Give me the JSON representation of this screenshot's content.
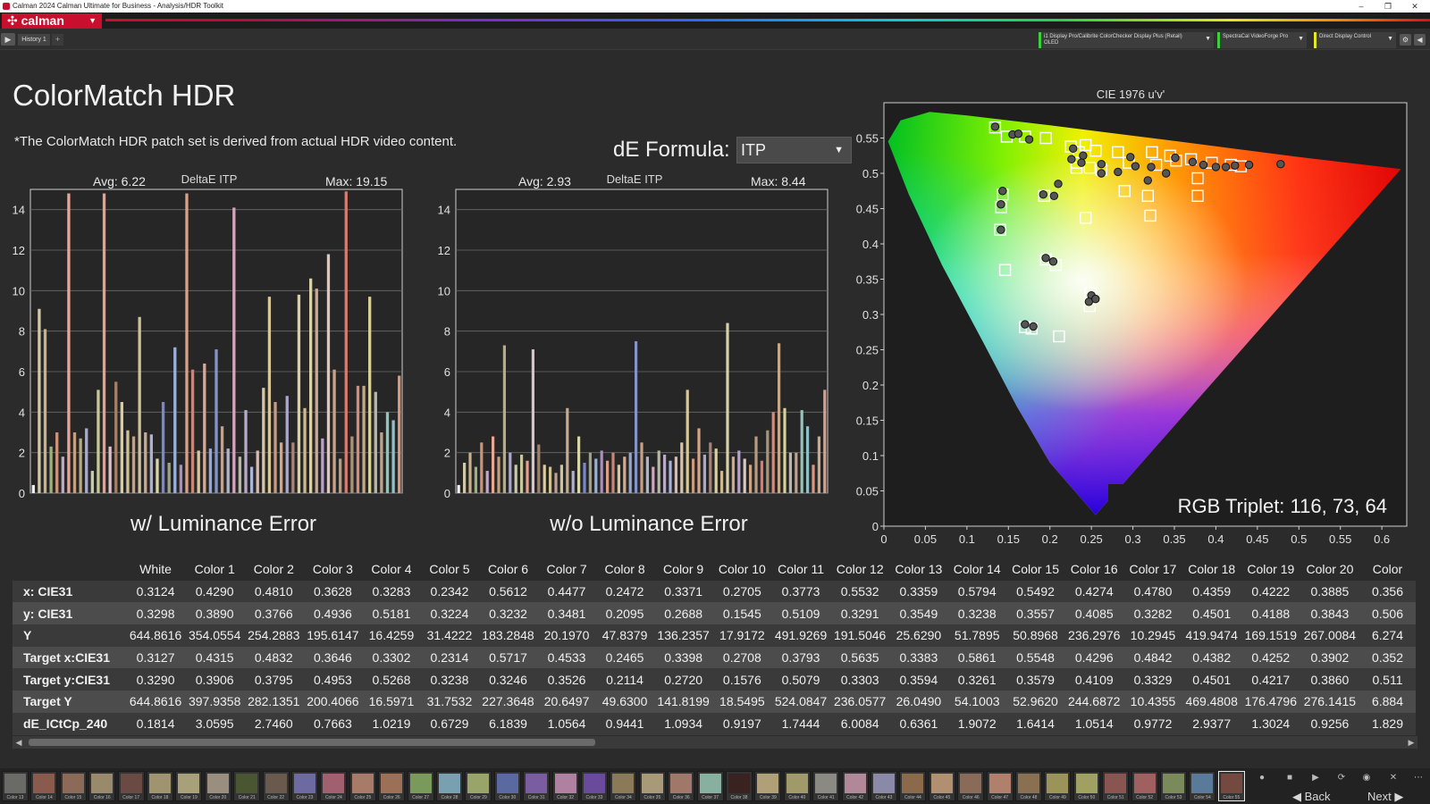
{
  "window": {
    "title": "Calman 2024 Calman Ultimate for Business - Analysis/HDR Toolkit",
    "controls": [
      "–",
      "❐",
      "✕"
    ]
  },
  "brand": {
    "logo": "calman"
  },
  "tabs": {
    "history": "History 1",
    "add": "+"
  },
  "devices": [
    {
      "line1": "i1 Display Pro/Calibrite ColorChecker Display Plus (Retail)",
      "line2": "OLED",
      "color": "#3bd13b"
    },
    {
      "line1": "SpectraCal VideoForge Pro",
      "line2": "",
      "color": "#3bd13b"
    },
    {
      "line1": "Direct Display Control",
      "line2": "",
      "color": "#e8e820"
    }
  ],
  "page": {
    "title": "ColorMatch HDR",
    "note": "*The ColorMatch HDR patch set is derived from actual HDR video content.",
    "formula_label": "dE Formula:",
    "formula_value": "ITP"
  },
  "chart_data": [
    {
      "type": "bar",
      "title": "DeltaE ITP",
      "caption": "w/ Luminance Error",
      "avg_label": "Avg: 6.22",
      "max_label": "Max: 19.15",
      "ylim": [
        0,
        15
      ],
      "yticks": [
        0,
        2,
        4,
        6,
        8,
        10,
        12,
        14
      ],
      "values": [
        0.4,
        9.1,
        8.1,
        2.3,
        3.0,
        1.8,
        14.8,
        3.0,
        2.7,
        3.2,
        1.1,
        5.1,
        14.8,
        2.3,
        5.5,
        4.5,
        3.1,
        2.8,
        8.7,
        3.0,
        2.9,
        1.7,
        4.5,
        1.5,
        7.2,
        1.4,
        14.8,
        6.1,
        2.1,
        6.4,
        2.2,
        7.1,
        3.3,
        2.2,
        14.1,
        1.8,
        4.1,
        1.3,
        2.1,
        5.2,
        9.7,
        4.5,
        2.5,
        4.8,
        2.5,
        9.8,
        4.2,
        10.6,
        10.1,
        2.7,
        11.8,
        6.1,
        1.7,
        14.9,
        2.8,
        5.3,
        5.3,
        9.7,
        5.0,
        3.0,
        4.0,
        3.6,
        5.8
      ],
      "colors": [
        "#f2f2f2",
        "#d0c8a8",
        "#c9b28a",
        "#9fb07c",
        "#cc9378",
        "#c0a8c8",
        "#e8a696",
        "#c3a07e",
        "#b8aa85",
        "#a8a8d0",
        "#c9c9b0",
        "#c8c79a",
        "#e8a08c",
        "#dbc2c8",
        "#a48068",
        "#d8cca0",
        "#cfc191",
        "#c0a090",
        "#cdc29a",
        "#c8aa8e",
        "#b0b0c8",
        "#d6d6a8",
        "#7b87c8",
        "#9ea288",
        "#9ab0d8",
        "#a890b8",
        "#d8a086",
        "#c6867a",
        "#d8c69a",
        "#d8a890",
        "#9aa8c8",
        "#8494c8",
        "#c8a088",
        "#b0b4c8",
        "#d6a4bc",
        "#b8b8a8",
        "#b8aac8",
        "#a8b4d8",
        "#dab8b0",
        "#d8c4a0",
        "#d8c899",
        "#c89a80",
        "#d6a588",
        "#a8a8c8",
        "#a88478",
        "#d9cfa2",
        "#cdb890",
        "#d8d0a8",
        "#cba892",
        "#b8a0d0",
        "#d8c8c0",
        "#c9a487",
        "#b89c80",
        "#d87b6e",
        "#a89478",
        "#d08c7c",
        "#c4a888",
        "#d8d098",
        "#b8b8a8",
        "#c0a48a",
        "#9ac0b8",
        "#8ec0c8",
        "#d89880"
      ]
    },
    {
      "type": "bar",
      "title": "DeltaE ITP",
      "caption": "w/o Luminance Error",
      "avg_label": "Avg: 2.93",
      "max_label": "Max: 8.44",
      "ylim": [
        0,
        15
      ],
      "yticks": [
        0,
        2,
        4,
        6,
        8,
        10,
        12,
        14
      ],
      "values": [
        0.4,
        1.5,
        2.0,
        1.3,
        2.5,
        1.1,
        2.8,
        1.8,
        7.3,
        2.0,
        1.4,
        1.9,
        1.6,
        7.1,
        2.4,
        1.4,
        1.3,
        1.0,
        1.4,
        4.2,
        1.1,
        2.8,
        1.5,
        2.0,
        1.7,
        2.1,
        1.6,
        2.0,
        1.4,
        1.8,
        2.0,
        7.5,
        2.5,
        1.8,
        1.3,
        2.1,
        1.9,
        1.6,
        1.8,
        2.5,
        5.1,
        1.7,
        3.2,
        1.9,
        2.5,
        2.2,
        1.1,
        8.4,
        1.8,
        2.1,
        1.7,
        1.4,
        2.8,
        1.6,
        3.1,
        4.0,
        7.4,
        4.2,
        2.0,
        2.0,
        4.1,
        3.3,
        1.4,
        2.8,
        5.1
      ],
      "colors": [
        "#f2f2f2",
        "#d0c8a8",
        "#c9b28a",
        "#9fb07c",
        "#cc9378",
        "#c0a8c8",
        "#e8a696",
        "#c3a07e",
        "#b8aa85",
        "#a8a8d0",
        "#c9c9b0",
        "#c8c79a",
        "#e8a08c",
        "#dbc2c8",
        "#a48068",
        "#d8cca0",
        "#cfc191",
        "#c0a090",
        "#cdc29a",
        "#c8aa8e",
        "#b0b0c8",
        "#d6d6a8",
        "#7b87c8",
        "#9ea288",
        "#9ab0d8",
        "#a890b8",
        "#d8a086",
        "#c6867a",
        "#d8c69a",
        "#d8a890",
        "#9aa8c8",
        "#8494c8",
        "#c8a088",
        "#b0b4c8",
        "#d6a4bc",
        "#b8b8a8",
        "#b8aac8",
        "#a8b4d8",
        "#dab8b0",
        "#d8c4a0",
        "#d8c899",
        "#c89a80",
        "#d6a588",
        "#a8a8c8",
        "#a88478",
        "#d9cfa2",
        "#cdb890",
        "#d8d0a8",
        "#cba892",
        "#b8a0d0",
        "#d8c8c0",
        "#c9a487",
        "#b89c80",
        "#d87b6e",
        "#a89478",
        "#d08c7c",
        "#c4a888",
        "#d8d098",
        "#b8b8a8",
        "#c0a48a",
        "#9ac0b8",
        "#8ec0c8",
        "#d89880",
        "#c8a890",
        "#d8a08c"
      ]
    },
    {
      "type": "scatter",
      "title": "CIE 1976 u'v'",
      "xlim": [
        0,
        0.63
      ],
      "ylim": [
        0,
        0.6
      ],
      "xticks": [
        "0",
        "0.05",
        "0.1",
        "0.15",
        "0.2",
        "0.25",
        "0.3",
        "0.35",
        "0.4",
        "0.45",
        "0.5",
        "0.55",
        "0.6"
      ],
      "yticks": [
        "0",
        "0.05",
        "0.1",
        "0.15",
        "0.2",
        "0.25",
        "0.3",
        "0.35",
        "0.4",
        "0.45",
        "0.5",
        "0.55"
      ],
      "readout": "RGB Triplet: 116, 73, 64",
      "targets": [
        [
          0.134,
          0.565
        ],
        [
          0.148,
          0.552
        ],
        [
          0.17,
          0.552
        ],
        [
          0.195,
          0.55
        ],
        [
          0.225,
          0.538
        ],
        [
          0.235,
          0.53
        ],
        [
          0.232,
          0.515
        ],
        [
          0.243,
          0.54
        ],
        [
          0.255,
          0.532
        ],
        [
          0.282,
          0.53
        ],
        [
          0.295,
          0.515
        ],
        [
          0.323,
          0.53
        ],
        [
          0.328,
          0.512
        ],
        [
          0.345,
          0.525
        ],
        [
          0.352,
          0.518
        ],
        [
          0.37,
          0.52
        ],
        [
          0.395,
          0.515
        ],
        [
          0.418,
          0.512
        ],
        [
          0.43,
          0.51
        ],
        [
          0.378,
          0.493
        ],
        [
          0.232,
          0.508
        ],
        [
          0.248,
          0.508
        ],
        [
          0.262,
          0.505
        ],
        [
          0.29,
          0.475
        ],
        [
          0.318,
          0.468
        ],
        [
          0.378,
          0.468
        ],
        [
          0.193,
          0.468
        ],
        [
          0.143,
          0.47
        ],
        [
          0.141,
          0.452
        ],
        [
          0.243,
          0.437
        ],
        [
          0.321,
          0.44
        ],
        [
          0.14,
          0.42
        ],
        [
          0.146,
          0.363
        ],
        [
          0.195,
          0.378
        ],
        [
          0.207,
          0.37
        ],
        [
          0.249,
          0.33
        ],
        [
          0.248,
          0.312
        ],
        [
          0.17,
          0.282
        ],
        [
          0.178,
          0.28
        ],
        [
          0.211,
          0.269
        ]
      ],
      "measured": [
        [
          0.134,
          0.566
        ],
        [
          0.155,
          0.555
        ],
        [
          0.162,
          0.556
        ],
        [
          0.175,
          0.548
        ],
        [
          0.228,
          0.535
        ],
        [
          0.24,
          0.525
        ],
        [
          0.226,
          0.52
        ],
        [
          0.238,
          0.515
        ],
        [
          0.262,
          0.513
        ],
        [
          0.297,
          0.523
        ],
        [
          0.303,
          0.51
        ],
        [
          0.322,
          0.509
        ],
        [
          0.34,
          0.5
        ],
        [
          0.351,
          0.522
        ],
        [
          0.372,
          0.516
        ],
        [
          0.385,
          0.512
        ],
        [
          0.4,
          0.509
        ],
        [
          0.412,
          0.509
        ],
        [
          0.423,
          0.511
        ],
        [
          0.44,
          0.512
        ],
        [
          0.21,
          0.485
        ],
        [
          0.205,
          0.468
        ],
        [
          0.143,
          0.475
        ],
        [
          0.141,
          0.456
        ],
        [
          0.141,
          0.42
        ],
        [
          0.195,
          0.38
        ],
        [
          0.204,
          0.375
        ],
        [
          0.25,
          0.327
        ],
        [
          0.247,
          0.318
        ],
        [
          0.17,
          0.286
        ],
        [
          0.18,
          0.283
        ],
        [
          0.255,
          0.322
        ],
        [
          0.478,
          0.513
        ],
        [
          0.318,
          0.49
        ],
        [
          0.282,
          0.502
        ],
        [
          0.262,
          0.5
        ],
        [
          0.192,
          0.47
        ]
      ]
    }
  ],
  "table": {
    "columns": [
      "",
      "White",
      "Color 1",
      "Color 2",
      "Color 3",
      "Color 4",
      "Color 5",
      "Color 6",
      "Color 7",
      "Color 8",
      "Color 9",
      "Color 10",
      "Color 11",
      "Color 12",
      "Color 13",
      "Color 14",
      "Color 15",
      "Color 16",
      "Color 17",
      "Color 18",
      "Color 19",
      "Color 20",
      "Color"
    ],
    "rows": [
      {
        "label": "x: CIE31",
        "values": [
          "0.3124",
          "0.4290",
          "0.4810",
          "0.3628",
          "0.3283",
          "0.2342",
          "0.5612",
          "0.4477",
          "0.2472",
          "0.3371",
          "0.2705",
          "0.3773",
          "0.5532",
          "0.3359",
          "0.5794",
          "0.5492",
          "0.4274",
          "0.4780",
          "0.4359",
          "0.4222",
          "0.3885",
          "0.356"
        ]
      },
      {
        "label": "y: CIE31",
        "values": [
          "0.3298",
          "0.3890",
          "0.3766",
          "0.4936",
          "0.5181",
          "0.3224",
          "0.3232",
          "0.3481",
          "0.2095",
          "0.2688",
          "0.1545",
          "0.5109",
          "0.3291",
          "0.3549",
          "0.3238",
          "0.3557",
          "0.4085",
          "0.3282",
          "0.4501",
          "0.4188",
          "0.3843",
          "0.506"
        ]
      },
      {
        "label": "Y",
        "values": [
          "644.8616",
          "354.0554",
          "254.2883",
          "195.6147",
          "16.4259",
          "31.4222",
          "183.2848",
          "20.1970",
          "47.8379",
          "136.2357",
          "17.9172",
          "491.9269",
          "191.5046",
          "25.6290",
          "51.7895",
          "50.8968",
          "236.2976",
          "10.2945",
          "419.9474",
          "169.1519",
          "267.0084",
          "6.274"
        ]
      },
      {
        "label": "Target x:CIE31",
        "values": [
          "0.3127",
          "0.4315",
          "0.4832",
          "0.3646",
          "0.3302",
          "0.2314",
          "0.5717",
          "0.4533",
          "0.2465",
          "0.3398",
          "0.2708",
          "0.3793",
          "0.5635",
          "0.3383",
          "0.5861",
          "0.5548",
          "0.4296",
          "0.4842",
          "0.4382",
          "0.4252",
          "0.3902",
          "0.352"
        ]
      },
      {
        "label": "Target y:CIE31",
        "values": [
          "0.3290",
          "0.3906",
          "0.3795",
          "0.4953",
          "0.5268",
          "0.3238",
          "0.3246",
          "0.3526",
          "0.2114",
          "0.2720",
          "0.1576",
          "0.5079",
          "0.3303",
          "0.3594",
          "0.3261",
          "0.3579",
          "0.4109",
          "0.3329",
          "0.4501",
          "0.4217",
          "0.3860",
          "0.511"
        ]
      },
      {
        "label": "Target Y",
        "values": [
          "644.8616",
          "397.9358",
          "282.1351",
          "200.4066",
          "16.5971",
          "31.7532",
          "227.3648",
          "20.6497",
          "49.6300",
          "141.8199",
          "18.5495",
          "524.0847",
          "236.0577",
          "26.0490",
          "54.1003",
          "52.9620",
          "244.6872",
          "10.4355",
          "469.4808",
          "176.4796",
          "276.1415",
          "6.884"
        ]
      },
      {
        "label": "dE_ICtCp_240",
        "values": [
          "0.1814",
          "3.0595",
          "2.7460",
          "0.7663",
          "1.0219",
          "0.6729",
          "6.1839",
          "1.0564",
          "0.9441",
          "1.0934",
          "0.9197",
          "1.7444",
          "6.0084",
          "0.6361",
          "1.9072",
          "1.6414",
          "1.0514",
          "0.9772",
          "2.9377",
          "1.3024",
          "0.9256",
          "1.829"
        ]
      }
    ]
  },
  "swatches": {
    "labels": [
      "Color 13",
      "Color 14",
      "Color 15",
      "Color 16",
      "Color 17",
      "Color 18",
      "Color 19",
      "Color 20",
      "Color 21",
      "Color 22",
      "Color 23",
      "Color 24",
      "Color 25",
      "Color 26",
      "Color 27",
      "Color 28",
      "Color 29",
      "Color 30",
      "Color 31",
      "Color 32",
      "Color 33",
      "Color 34",
      "Color 35",
      "Color 36",
      "Color 37",
      "Color 38",
      "Color 39",
      "Color 40",
      "Color 41",
      "Color 42",
      "Color 43",
      "Color 44",
      "Color 45",
      "Color 46",
      "Color 47",
      "Color 48",
      "Color 49",
      "Color 50",
      "Color 51",
      "Color 52",
      "Color 53",
      "Color 54",
      "Color 55"
    ],
    "colors": [
      "#6a6a66",
      "#8a5a4c",
      "#8c6a58",
      "#9a8a6c",
      "#6a4a42",
      "#a09470",
      "#a8a078",
      "#9a8e7e",
      "#4a5632",
      "#6a5a4e",
      "#6c6aa0",
      "#a06070",
      "#a87a68",
      "#9c7056",
      "#7a9a5c",
      "#78a0b0",
      "#98a468",
      "#5a6aa0",
      "#7a5ca0",
      "#b080a0",
      "#6a4a9a",
      "#8a7a58",
      "#a89a78",
      "#a0786a",
      "#88b0a0",
      "#3a2220",
      "#b0a078",
      "#a09a6a",
      "#8a8a82",
      "#b08898",
      "#8a8aa8",
      "#8a6a4a",
      "#b09070",
      "#8a6a58",
      "#b0806c",
      "#8a7050",
      "#9a9458",
      "#a0a060",
      "#8a5450",
      "#a06060",
      "#7a8a5a",
      "#5a7a9a",
      "#74493f"
    ],
    "active_index": 42
  },
  "nav": {
    "back": "Back",
    "next": "Next"
  }
}
